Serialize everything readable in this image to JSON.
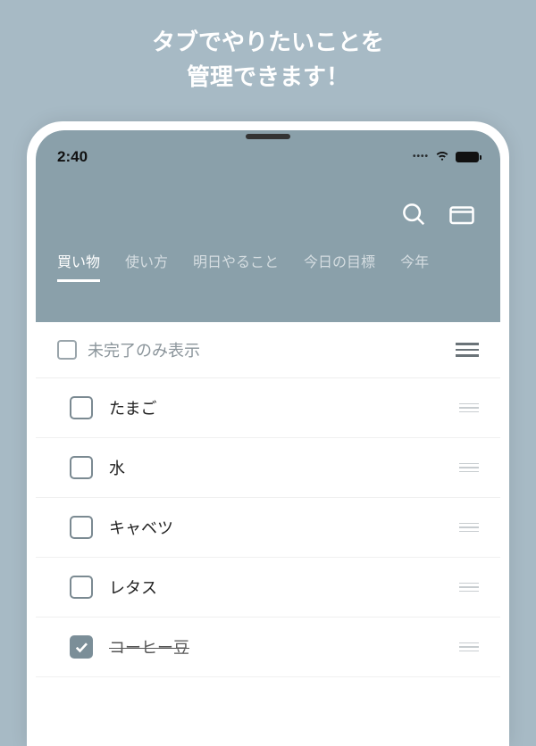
{
  "promo": {
    "line1": "タブでやりたいことを",
    "line2": "管理できます！"
  },
  "status": {
    "time": "2:40"
  },
  "tabs": [
    {
      "label": "買い物",
      "active": true
    },
    {
      "label": "使い方",
      "active": false
    },
    {
      "label": "明日やること",
      "active": false
    },
    {
      "label": "今日の目標",
      "active": false
    },
    {
      "label": "今年",
      "active": false
    }
  ],
  "filter": {
    "label": "未完了のみ表示"
  },
  "items": [
    {
      "label": "たまご",
      "checked": false
    },
    {
      "label": "水",
      "checked": false
    },
    {
      "label": "キャベツ",
      "checked": false
    },
    {
      "label": "レタス",
      "checked": false
    },
    {
      "label": "コーヒー豆",
      "checked": true
    }
  ]
}
